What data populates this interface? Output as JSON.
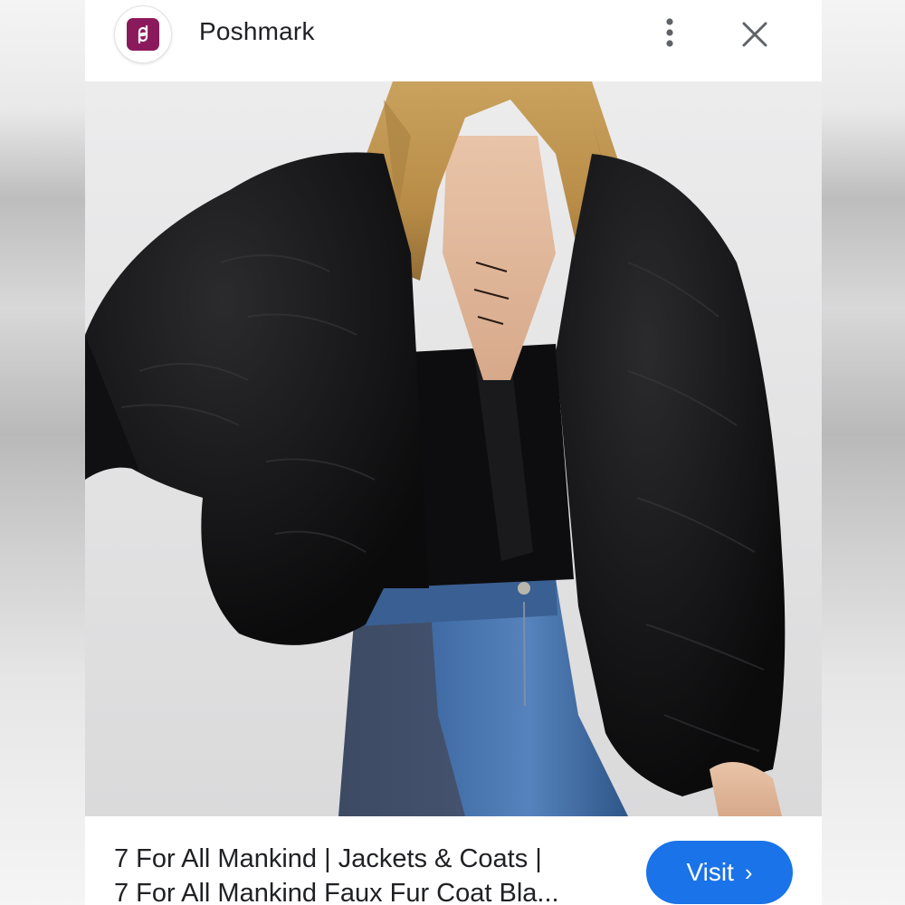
{
  "header": {
    "site_name": "Poshmark",
    "site_icon": "poshmark-logo-icon",
    "menu_icon": "more-vert-icon",
    "close_icon": "close-icon"
  },
  "image": {
    "subject": "black faux fur cropped jacket over black lace-up top and two-tone jeans"
  },
  "footer": {
    "title_line_1": "7 For All Mankind | Jackets & Coats |",
    "title_line_2": "7 For All Mankind Faux Fur Coat Bla...",
    "visit_label": "Visit",
    "visit_chevron": "›"
  },
  "colors": {
    "brand": "#8b1a5c",
    "visit_button": "#1a73e8",
    "text": "#202124"
  }
}
